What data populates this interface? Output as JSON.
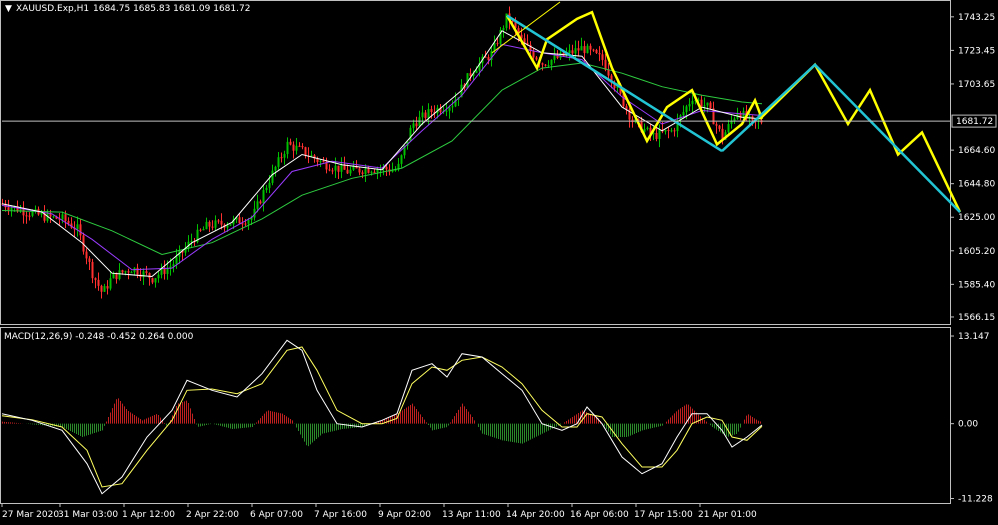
{
  "header": {
    "symbol": "XAUUSD.Exp,H1",
    "ohlc": "1684.75 1685.83 1681.09 1681.72",
    "macd_label": "MACD(12,26,9) -0.248 -0.452 0.264 0.000"
  },
  "colors": {
    "background": "#000000",
    "grid_border": "#c0c0c0",
    "bull_candle": "#00c000",
    "bear_candle": "#ff3030",
    "ma_fast": "#ffffff",
    "ma_mid": "#9a3cff",
    "ma_slow": "#2ecc40",
    "forecast_yellow": "#ffff00",
    "forecast_cyan": "#22c4d4",
    "macd_hist_pos": "#c02020",
    "macd_hist_neg": "#2a8a2a",
    "macd_line": "#ffffff",
    "signal_line": "#ffff60"
  },
  "chart_data": [
    {
      "type": "candlestick",
      "symbol": "XAUUSD.Exp",
      "timeframe": "H1",
      "current_price": 1681.72,
      "current_price_label": "1681.72",
      "ylim": [
        1562,
        1752
      ],
      "y_ticks": [
        {
          "value": 1743.25,
          "label": "1743.25"
        },
        {
          "value": 1723.45,
          "label": "1723.45"
        },
        {
          "value": 1703.65,
          "label": "1703.65"
        },
        {
          "value": 1664.6,
          "label": "1664.60"
        },
        {
          "value": 1644.8,
          "label": "1644.80"
        },
        {
          "value": 1625.0,
          "label": "1625.00"
        },
        {
          "value": 1605.2,
          "label": "1605.20"
        },
        {
          "value": 1585.4,
          "label": "1585.40"
        },
        {
          "value": 1566.15,
          "label": "1566.15"
        }
      ],
      "x_ticks": [
        {
          "label": "27 Mar 2020",
          "bar": 0
        },
        {
          "label": "31 Mar 03:00",
          "bar": 58
        },
        {
          "label": "1 Apr 12:00",
          "bar": 122
        },
        {
          "label": "2 Apr 22:00",
          "bar": 186
        },
        {
          "label": "6 Apr 07:00",
          "bar": 250
        },
        {
          "label": "7 Apr 16:00",
          "bar": 314
        },
        {
          "label": "9 Apr 02:00",
          "bar": 378
        },
        {
          "label": "13 Apr 11:00",
          "bar": 442
        },
        {
          "label": "14 Apr 20:00",
          "bar": 506
        },
        {
          "label": "16 Apr 06:00",
          "bar": 570
        },
        {
          "label": "17 Apr 15:00",
          "bar": 634
        },
        {
          "label": "21 Apr 01:00",
          "bar": 698
        }
      ],
      "bars_total": 760,
      "price_path": [
        [
          0,
          1633
        ],
        [
          25,
          1628
        ],
        [
          45,
          1625
        ],
        [
          60,
          1624
        ],
        [
          75,
          1618
        ],
        [
          90,
          1592
        ],
        [
          100,
          1580
        ],
        [
          110,
          1590
        ],
        [
          130,
          1595
        ],
        [
          150,
          1589
        ],
        [
          170,
          1597
        ],
        [
          190,
          1612
        ],
        [
          205,
          1620
        ],
        [
          230,
          1622
        ],
        [
          250,
          1625
        ],
        [
          265,
          1645
        ],
        [
          285,
          1668
        ],
        [
          300,
          1664
        ],
        [
          320,
          1657
        ],
        [
          345,
          1652
        ],
        [
          370,
          1654
        ],
        [
          395,
          1653
        ],
        [
          410,
          1680
        ],
        [
          430,
          1688
        ],
        [
          450,
          1692
        ],
        [
          470,
          1712
        ],
        [
          490,
          1722
        ],
        [
          505,
          1744
        ],
        [
          520,
          1728
        ],
        [
          540,
          1716
        ],
        [
          560,
          1720
        ],
        [
          580,
          1725
        ],
        [
          600,
          1718
        ],
        [
          615,
          1700
        ],
        [
          630,
          1682
        ],
        [
          650,
          1673
        ],
        [
          670,
          1676
        ],
        [
          690,
          1696
        ],
        [
          705,
          1690
        ],
        [
          720,
          1672
        ],
        [
          735,
          1688
        ],
        [
          750,
          1680
        ],
        [
          760,
          1682
        ]
      ],
      "ma_fast_path": [
        [
          0,
          1633
        ],
        [
          40,
          1628
        ],
        [
          80,
          1610
        ],
        [
          110,
          1592
        ],
        [
          150,
          1590
        ],
        [
          190,
          1610
        ],
        [
          230,
          1622
        ],
        [
          270,
          1650
        ],
        [
          300,
          1662
        ],
        [
          340,
          1656
        ],
        [
          380,
          1653
        ],
        [
          420,
          1680
        ],
        [
          460,
          1700
        ],
        [
          500,
          1735
        ],
        [
          540,
          1722
        ],
        [
          580,
          1720
        ],
        [
          620,
          1690
        ],
        [
          660,
          1676
        ],
        [
          700,
          1690
        ],
        [
          740,
          1684
        ],
        [
          760,
          1683
        ]
      ],
      "ma_mid_path": [
        [
          0,
          1632
        ],
        [
          50,
          1627
        ],
        [
          90,
          1612
        ],
        [
          130,
          1594
        ],
        [
          170,
          1595
        ],
        [
          210,
          1612
        ],
        [
          250,
          1625
        ],
        [
          290,
          1652
        ],
        [
          330,
          1658
        ],
        [
          380,
          1654
        ],
        [
          420,
          1676
        ],
        [
          460,
          1697
        ],
        [
          500,
          1727
        ],
        [
          540,
          1722
        ],
        [
          580,
          1718
        ],
        [
          620,
          1696
        ],
        [
          660,
          1680
        ],
        [
          700,
          1688
        ],
        [
          740,
          1686
        ],
        [
          760,
          1685
        ]
      ],
      "ma_slow_path": [
        [
          0,
          1629
        ],
        [
          60,
          1628
        ],
        [
          110,
          1617
        ],
        [
          160,
          1603
        ],
        [
          210,
          1610
        ],
        [
          260,
          1624
        ],
        [
          300,
          1638
        ],
        [
          350,
          1648
        ],
        [
          400,
          1654
        ],
        [
          450,
          1670
        ],
        [
          500,
          1700
        ],
        [
          540,
          1713
        ],
        [
          580,
          1716
        ],
        [
          620,
          1710
        ],
        [
          660,
          1702
        ],
        [
          700,
          1697
        ],
        [
          740,
          1693
        ],
        [
          760,
          1692
        ]
      ],
      "forecast_yellow": [
        [
          505,
          1744
        ],
        [
          535,
          1713
        ],
        [
          545,
          1730
        ],
        [
          575,
          1742
        ],
        [
          590,
          1746
        ],
        [
          610,
          1713
        ],
        [
          645,
          1670
        ],
        [
          665,
          1690
        ],
        [
          690,
          1700
        ],
        [
          715,
          1668
        ],
        [
          740,
          1680
        ],
        [
          753,
          1694
        ],
        [
          760,
          1683
        ]
      ],
      "forecast_cyan": [
        [
          505,
          1744
        ],
        [
          720,
          1664
        ]
      ],
      "overlay_bar_per_px": 1.0
    },
    {
      "type": "bar+line",
      "name": "MACD(12,26,9)",
      "values_label": "-0.248 -0.452 0.264 0.000",
      "ylim": [
        -11.9,
        14.2
      ],
      "y_ticks": [
        {
          "value": 13.147,
          "label": "13.147"
        },
        {
          "value": 0.0,
          "label": "0.00"
        },
        {
          "value": -11.228,
          "label": "-11.228"
        }
      ],
      "macd_path": [
        [
          0,
          1.5
        ],
        [
          30,
          0.5
        ],
        [
          60,
          -1
        ],
        [
          85,
          -6
        ],
        [
          100,
          -10.5
        ],
        [
          120,
          -8
        ],
        [
          145,
          -2
        ],
        [
          170,
          2
        ],
        [
          185,
          6.5
        ],
        [
          210,
          5
        ],
        [
          235,
          4
        ],
        [
          260,
          7.5
        ],
        [
          285,
          12.5
        ],
        [
          300,
          11
        ],
        [
          315,
          5
        ],
        [
          335,
          0
        ],
        [
          360,
          -0.5
        ],
        [
          380,
          0.5
        ],
        [
          395,
          1.5
        ],
        [
          410,
          8
        ],
        [
          430,
          9
        ],
        [
          445,
          7
        ],
        [
          460,
          10.5
        ],
        [
          480,
          10
        ],
        [
          500,
          7.5
        ],
        [
          520,
          5
        ],
        [
          540,
          0
        ],
        [
          560,
          -1
        ],
        [
          575,
          0
        ],
        [
          585,
          2.5
        ],
        [
          600,
          0
        ],
        [
          620,
          -5
        ],
        [
          640,
          -7.5
        ],
        [
          660,
          -6
        ],
        [
          675,
          -2
        ],
        [
          690,
          1.5
        ],
        [
          705,
          1.5
        ],
        [
          720,
          -1
        ],
        [
          730,
          -3.5
        ],
        [
          745,
          -2
        ],
        [
          760,
          -0.2
        ]
      ],
      "signal_path": [
        [
          0,
          1.2
        ],
        [
          30,
          0.6
        ],
        [
          60,
          -0.5
        ],
        [
          85,
          -4
        ],
        [
          100,
          -9.5
        ],
        [
          120,
          -9
        ],
        [
          145,
          -4
        ],
        [
          170,
          0.5
        ],
        [
          185,
          5
        ],
        [
          210,
          5.2
        ],
        [
          235,
          4.5
        ],
        [
          260,
          6
        ],
        [
          285,
          11
        ],
        [
          300,
          11.5
        ],
        [
          315,
          8
        ],
        [
          335,
          2
        ],
        [
          360,
          0
        ],
        [
          380,
          0
        ],
        [
          395,
          0.8
        ],
        [
          410,
          6
        ],
        [
          430,
          8.5
        ],
        [
          445,
          8
        ],
        [
          460,
          9.5
        ],
        [
          480,
          10
        ],
        [
          500,
          8.5
        ],
        [
          520,
          6
        ],
        [
          540,
          2
        ],
        [
          560,
          -0.5
        ],
        [
          575,
          -0.5
        ],
        [
          585,
          1.5
        ],
        [
          600,
          1
        ],
        [
          620,
          -3
        ],
        [
          640,
          -6.5
        ],
        [
          660,
          -6.5
        ],
        [
          675,
          -4
        ],
        [
          690,
          0
        ],
        [
          705,
          1
        ],
        [
          720,
          0.5
        ],
        [
          730,
          -2
        ],
        [
          745,
          -2.5
        ],
        [
          760,
          -0.4
        ]
      ],
      "histogram_envelope": [
        [
          0,
          0.3
        ],
        [
          30,
          -0.1
        ],
        [
          60,
          -0.5
        ],
        [
          80,
          -2
        ],
        [
          100,
          -1
        ],
        [
          115,
          4
        ],
        [
          125,
          2
        ],
        [
          140,
          0.5
        ],
        [
          155,
          1.5
        ],
        [
          165,
          -0.5
        ],
        [
          175,
          3
        ],
        [
          185,
          3.5
        ],
        [
          195,
          -0.5
        ],
        [
          210,
          0
        ],
        [
          230,
          -0.8
        ],
        [
          250,
          -0.5
        ],
        [
          265,
          2
        ],
        [
          280,
          1.5
        ],
        [
          290,
          0.5
        ],
        [
          305,
          -3.5
        ],
        [
          320,
          -1.5
        ],
        [
          340,
          -0.8
        ],
        [
          360,
          -0.5
        ],
        [
          380,
          0.5
        ],
        [
          395,
          1.5
        ],
        [
          410,
          3
        ],
        [
          420,
          1
        ],
        [
          430,
          -1
        ],
        [
          445,
          -0.5
        ],
        [
          460,
          3
        ],
        [
          470,
          1
        ],
        [
          480,
          -1.5
        ],
        [
          500,
          -2.5
        ],
        [
          520,
          -3
        ],
        [
          540,
          -1.5
        ],
        [
          560,
          0
        ],
        [
          580,
          2
        ],
        [
          595,
          1
        ],
        [
          610,
          -2
        ],
        [
          625,
          -2
        ],
        [
          640,
          -1
        ],
        [
          660,
          -0.3
        ],
        [
          675,
          2
        ],
        [
          685,
          3
        ],
        [
          695,
          1.5
        ],
        [
          710,
          -0.5
        ],
        [
          725,
          -2
        ],
        [
          735,
          -1.5
        ],
        [
          745,
          1.5
        ],
        [
          755,
          0.5
        ],
        [
          760,
          0.2
        ]
      ]
    }
  ]
}
